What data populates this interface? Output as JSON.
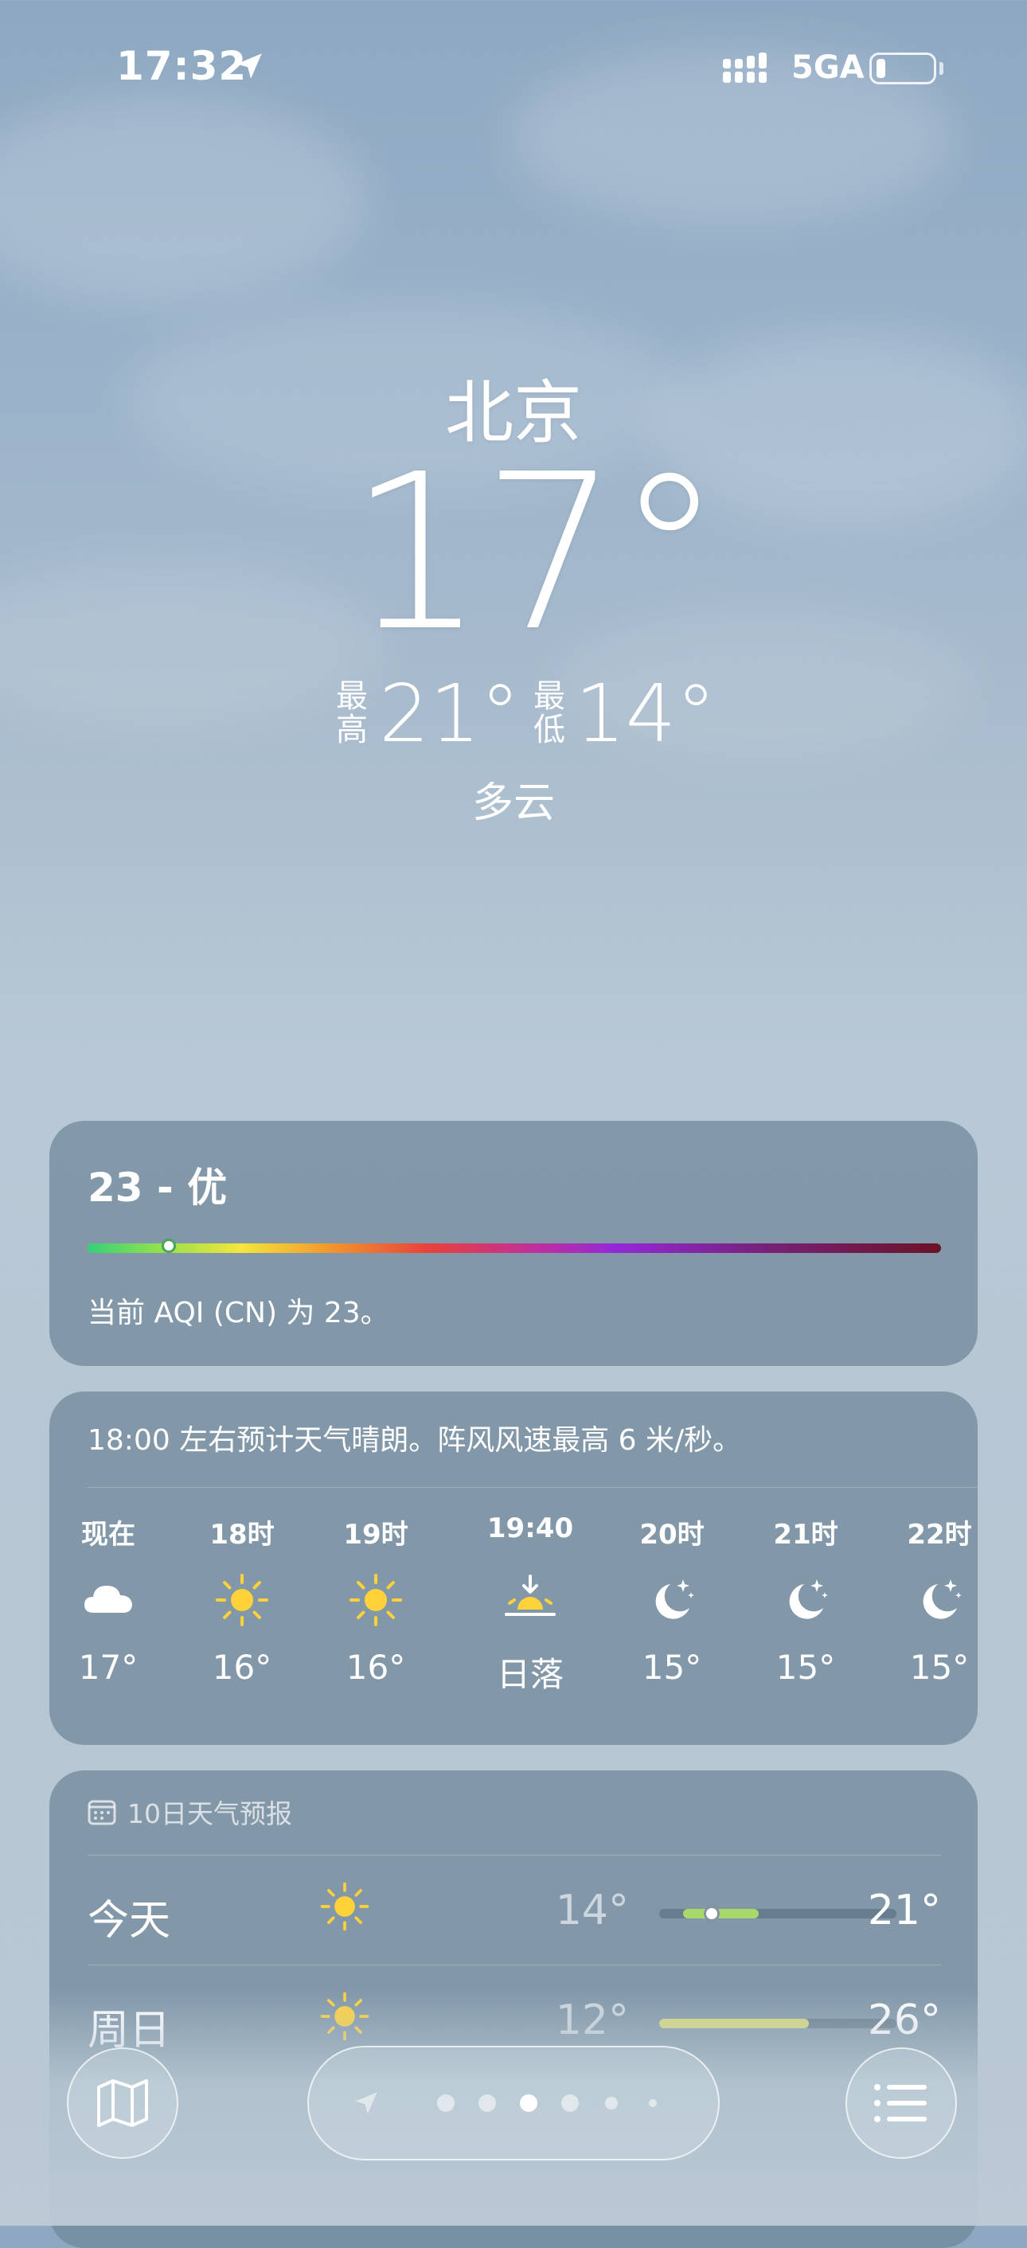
{
  "status_bar": {
    "time": "17:32",
    "network": "5GA",
    "location_icon": "location-arrow-icon",
    "battery_level": 0.15
  },
  "current": {
    "city": "北京",
    "temperature": "17°",
    "high_label": "最高",
    "high": "21°",
    "low_label": "最低",
    "low": "14°",
    "condition": "多云"
  },
  "aqi": {
    "title": "23 - 优",
    "value": 23,
    "description": "当前 AQI (CN) 为 23。"
  },
  "hourly": {
    "summary": "18:00 左右预计天气晴朗。阵风风速最高 6 米/秒。",
    "items": [
      {
        "label": "现在",
        "icon": "cloud-icon",
        "value": "17°"
      },
      {
        "label": "18时",
        "icon": "sun-icon",
        "value": "16°"
      },
      {
        "label": "19时",
        "icon": "sun-icon",
        "value": "16°"
      },
      {
        "label": "19:40",
        "icon": "sunset-icon",
        "value": "日落"
      },
      {
        "label": "20时",
        "icon": "moon-stars-icon",
        "value": "15°"
      },
      {
        "label": "21时",
        "icon": "moon-stars-icon",
        "value": "15°"
      },
      {
        "label": "22时",
        "icon": "moon-stars-icon",
        "value": "15°"
      }
    ]
  },
  "forecast": {
    "header": "10日天气预报",
    "rows": [
      {
        "day": "今天",
        "icon": "sun-icon",
        "low": "14°",
        "high": "21°",
        "range_start": 0.1,
        "range_end": 0.42,
        "now": 0.22,
        "range_color": "#a8d86a"
      },
      {
        "day": "周日",
        "icon": "sun-icon",
        "low": "12°",
        "high": "26°",
        "range_start": 0.0,
        "range_end": 0.63,
        "range_color": "#d8d87a"
      }
    ]
  },
  "toolbar": {
    "map_icon": "map-icon",
    "list_icon": "list-icon",
    "page_count": 7,
    "current_page": 3
  },
  "colors": {
    "card_bg": "#6e8698",
    "sun": "#ffd23a"
  }
}
